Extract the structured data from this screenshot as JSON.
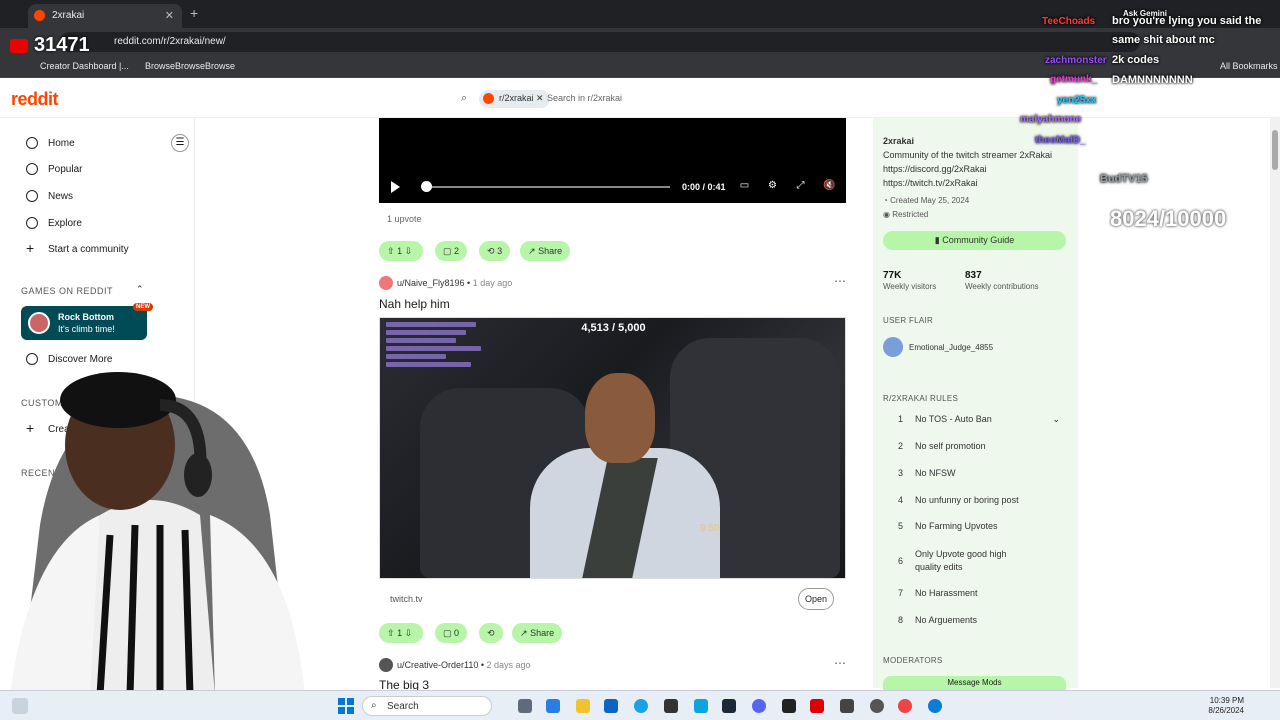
{
  "browser": {
    "tab_title": "2xrakai",
    "url": "reddit.com/r/2xrakai/new/",
    "bookmarks": [
      "Creator Dashboard |...",
      "BrowseBrowseBrowse",
      "All Bookmarks"
    ]
  },
  "stream_overlay": {
    "viewer_count": "31471",
    "chat": [
      {
        "user": "TeeChoads",
        "text": "bro you're lying you said the"
      },
      {
        "user": "",
        "text": "same shit about mc"
      },
      {
        "user": "zachmonster",
        "text": "2k codes"
      },
      {
        "user": "getmunk_",
        "text": "DAMNNNNNNN"
      },
      {
        "user": "yen25xx",
        "text": ""
      },
      {
        "user": "malyahmone",
        "text": ""
      },
      {
        "user": "theoMalD_",
        "text": ""
      },
      {
        "user": "BudTV15",
        "text": ""
      }
    ],
    "ask_label": "Ask Gemini",
    "goal_text": "8024/10000"
  },
  "reddit": {
    "logo": "reddit",
    "search_chip": "r/2xrakai",
    "search_placeholder": "Search in r/2xrakai"
  },
  "sidebar": {
    "items": [
      {
        "label": "Home"
      },
      {
        "label": "Popular"
      },
      {
        "label": "News"
      },
      {
        "label": "Explore"
      },
      {
        "label": "Start a community"
      }
    ],
    "games_header": "GAMES ON REDDIT",
    "game": {
      "name": "Rock Bottom",
      "sub": "It's climb time!",
      "badge": "NEW"
    },
    "discover": "Discover More",
    "custom_header": "CUSTOM",
    "create_label": "Crea",
    "recent_header": "RECENT"
  },
  "posts": [
    {
      "video": {
        "time": "0:00 / 0:41",
        "progress": 0
      },
      "upvotes_text": "1 upvote",
      "votes": "1",
      "comments": "2",
      "crossposts": "3",
      "share": "Share"
    },
    {
      "author": "u/Naive_Fly8196",
      "ago": "1 day ago",
      "title": "Nah help him",
      "counter": "4,513 / 5,000",
      "clock": "9:50",
      "source": "twitch.tv",
      "open": "Open",
      "votes": "1",
      "comments": "0",
      "share": "Share"
    },
    {
      "author": "u/Creative-Order110",
      "ago": "2 days ago",
      "title": "The big 3"
    }
  ],
  "community": {
    "name": "2xrakai",
    "desc": "Community of the twitch streamer 2xRakai",
    "links": [
      "https://discord.gg/2xRakai",
      "https://twitch.tv/2xRakai"
    ],
    "created": "Created May 25, 2024",
    "restricted": "Restricted",
    "guide_btn": "Community Guide",
    "stats": [
      {
        "value": "77K",
        "label": "Weekly visitors"
      },
      {
        "value": "837",
        "label": "Weekly contributions"
      }
    ],
    "flair_header": "USER FLAIR",
    "flair": "Emotional_Judge_4855",
    "rules_header": "R/2XRAKAI RULES",
    "rules": [
      {
        "n": "1",
        "t": "No TOS - Auto Ban"
      },
      {
        "n": "2",
        "t": "No self promotion"
      },
      {
        "n": "3",
        "t": "No NFSW"
      },
      {
        "n": "4",
        "t": "No unfunny or boring post"
      },
      {
        "n": "5",
        "t": "No Farming Upvotes"
      },
      {
        "n": "6",
        "t": "Only Upvote good high quality edits"
      },
      {
        "n": "7",
        "t": "No Harassment"
      },
      {
        "n": "8",
        "t": "No Arguements"
      }
    ],
    "mods_header": "MODERATORS",
    "message_mods": "Message Mods"
  },
  "taskbar": {
    "search": "Search",
    "time": "10:39 PM",
    "date": "8/26/2024"
  },
  "colors": {
    "accent": "#ff4500",
    "pill": "#b7f5a8",
    "sidebar_bg": "#eef8ec"
  }
}
